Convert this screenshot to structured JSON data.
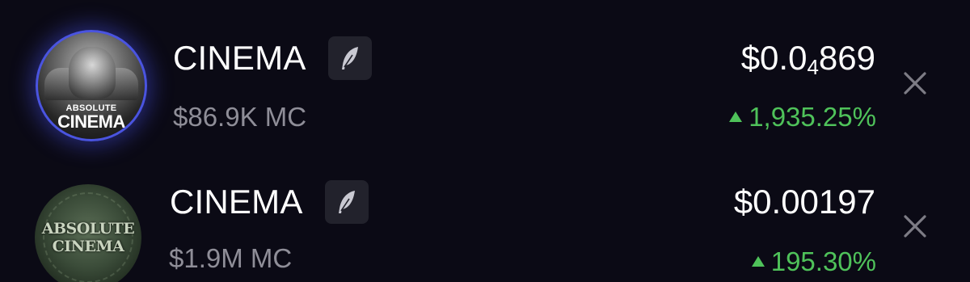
{
  "watchlist": {
    "items": [
      {
        "name": "CINEMA",
        "avatar_caption_small": "ABSOLUTE",
        "avatar_caption_big": "CINEMA",
        "price_prefix": "$0.0",
        "price_subscript": "4",
        "price_suffix": "869",
        "market_cap": "$86.9K MC",
        "change": "1,935.25%",
        "change_direction": "up",
        "change_color": "#4fc25a",
        "badge_icon": "quill-icon",
        "close_icon": "close-icon"
      },
      {
        "name": "CINEMA",
        "avatar_logo_top": "ABSOLUTE",
        "avatar_logo_bottom": "CINEMA",
        "price": "$0.00197",
        "market_cap": "$1.9M MC",
        "change": "195.30%",
        "change_direction": "up",
        "change_color": "#4fc25a",
        "badge_icon": "quill-icon",
        "close_icon": "close-icon"
      }
    ]
  },
  "colors": {
    "background": "#0b0a15",
    "accent_ring": "#4a54e0",
    "muted_text": "#8f8e98",
    "positive": "#4fc25a",
    "badge_bg": "#22222c"
  }
}
